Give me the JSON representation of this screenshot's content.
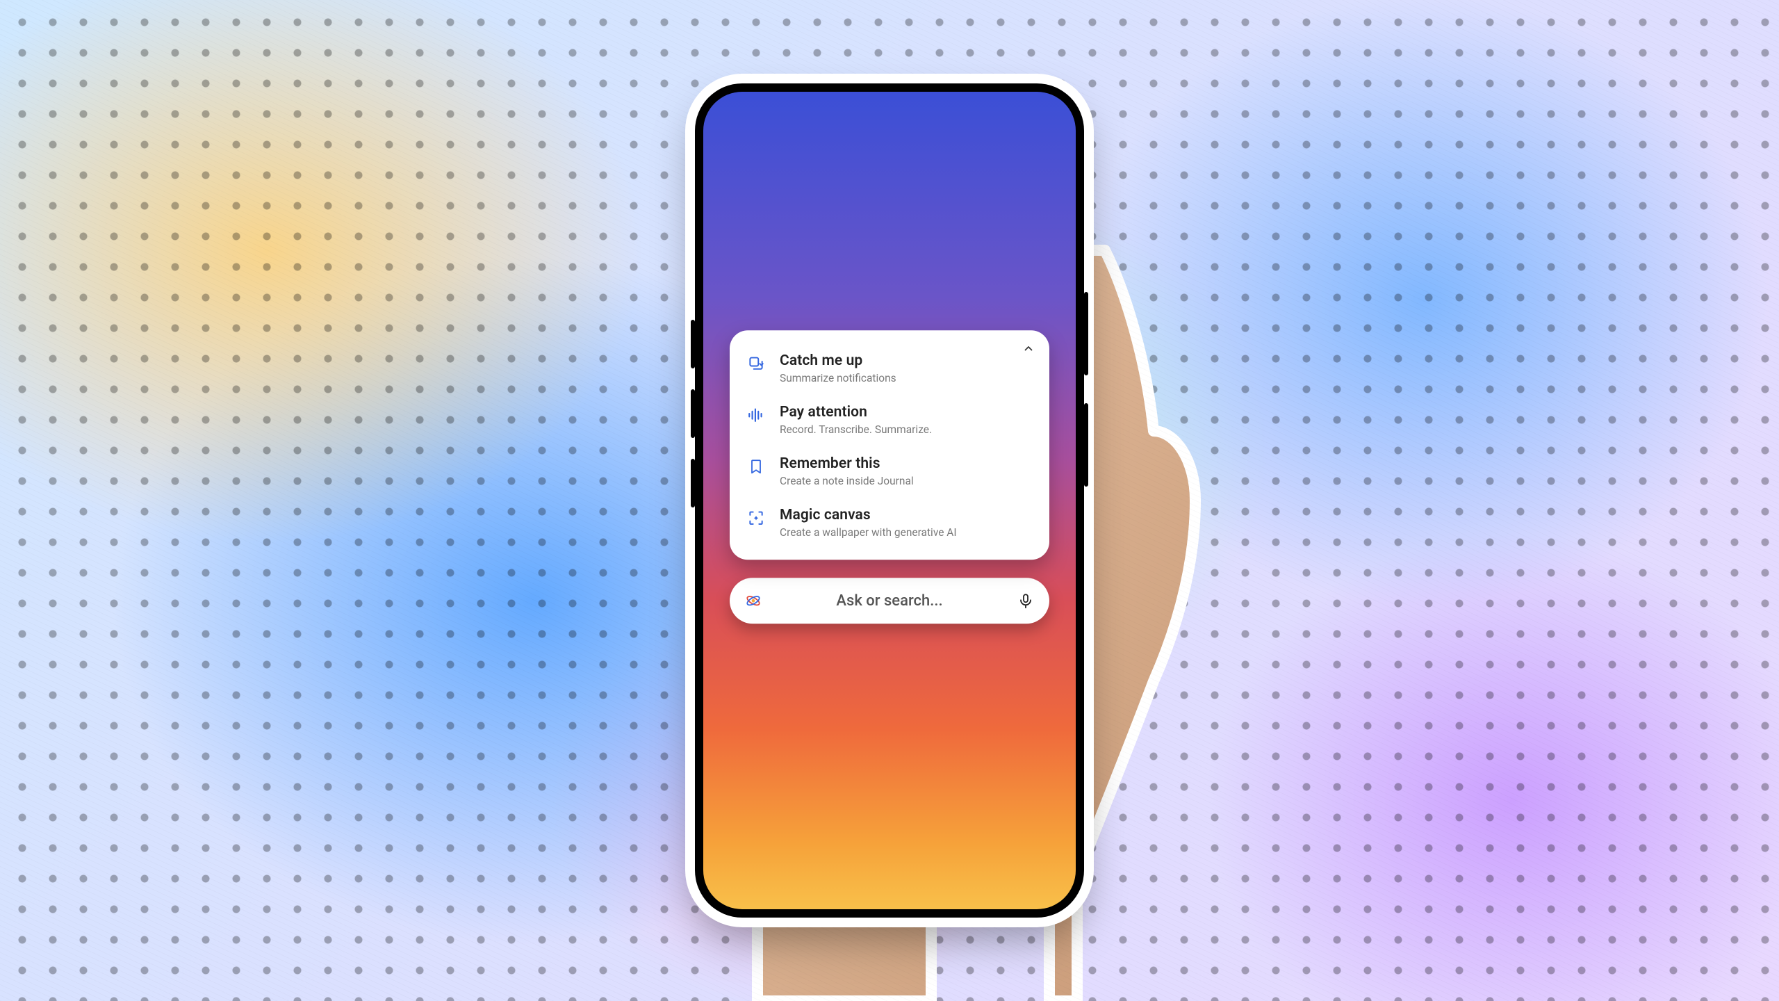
{
  "assistant_card": {
    "items": [
      {
        "icon": "copy-refresh-icon",
        "title": "Catch me up",
        "subtitle": "Summarize notifications"
      },
      {
        "icon": "waveform-icon",
        "title": "Pay attention",
        "subtitle": "Record. Transcribe. Summarize."
      },
      {
        "icon": "bookmark-icon",
        "title": "Remember this",
        "subtitle": "Create a note inside Journal"
      },
      {
        "icon": "frame-sparkle-icon",
        "title": "Magic canvas",
        "subtitle": "Create a wallpaper with generative AI"
      }
    ],
    "collapse_icon": "chevron-up-icon"
  },
  "search": {
    "placeholder": "Ask or search...",
    "left_icon": "sparkle-atom-icon",
    "right_icon": "microphone-icon"
  },
  "colors": {
    "icon_blue": "#3467e0",
    "text_primary": "#222222",
    "text_secondary": "#7a7a7a"
  }
}
